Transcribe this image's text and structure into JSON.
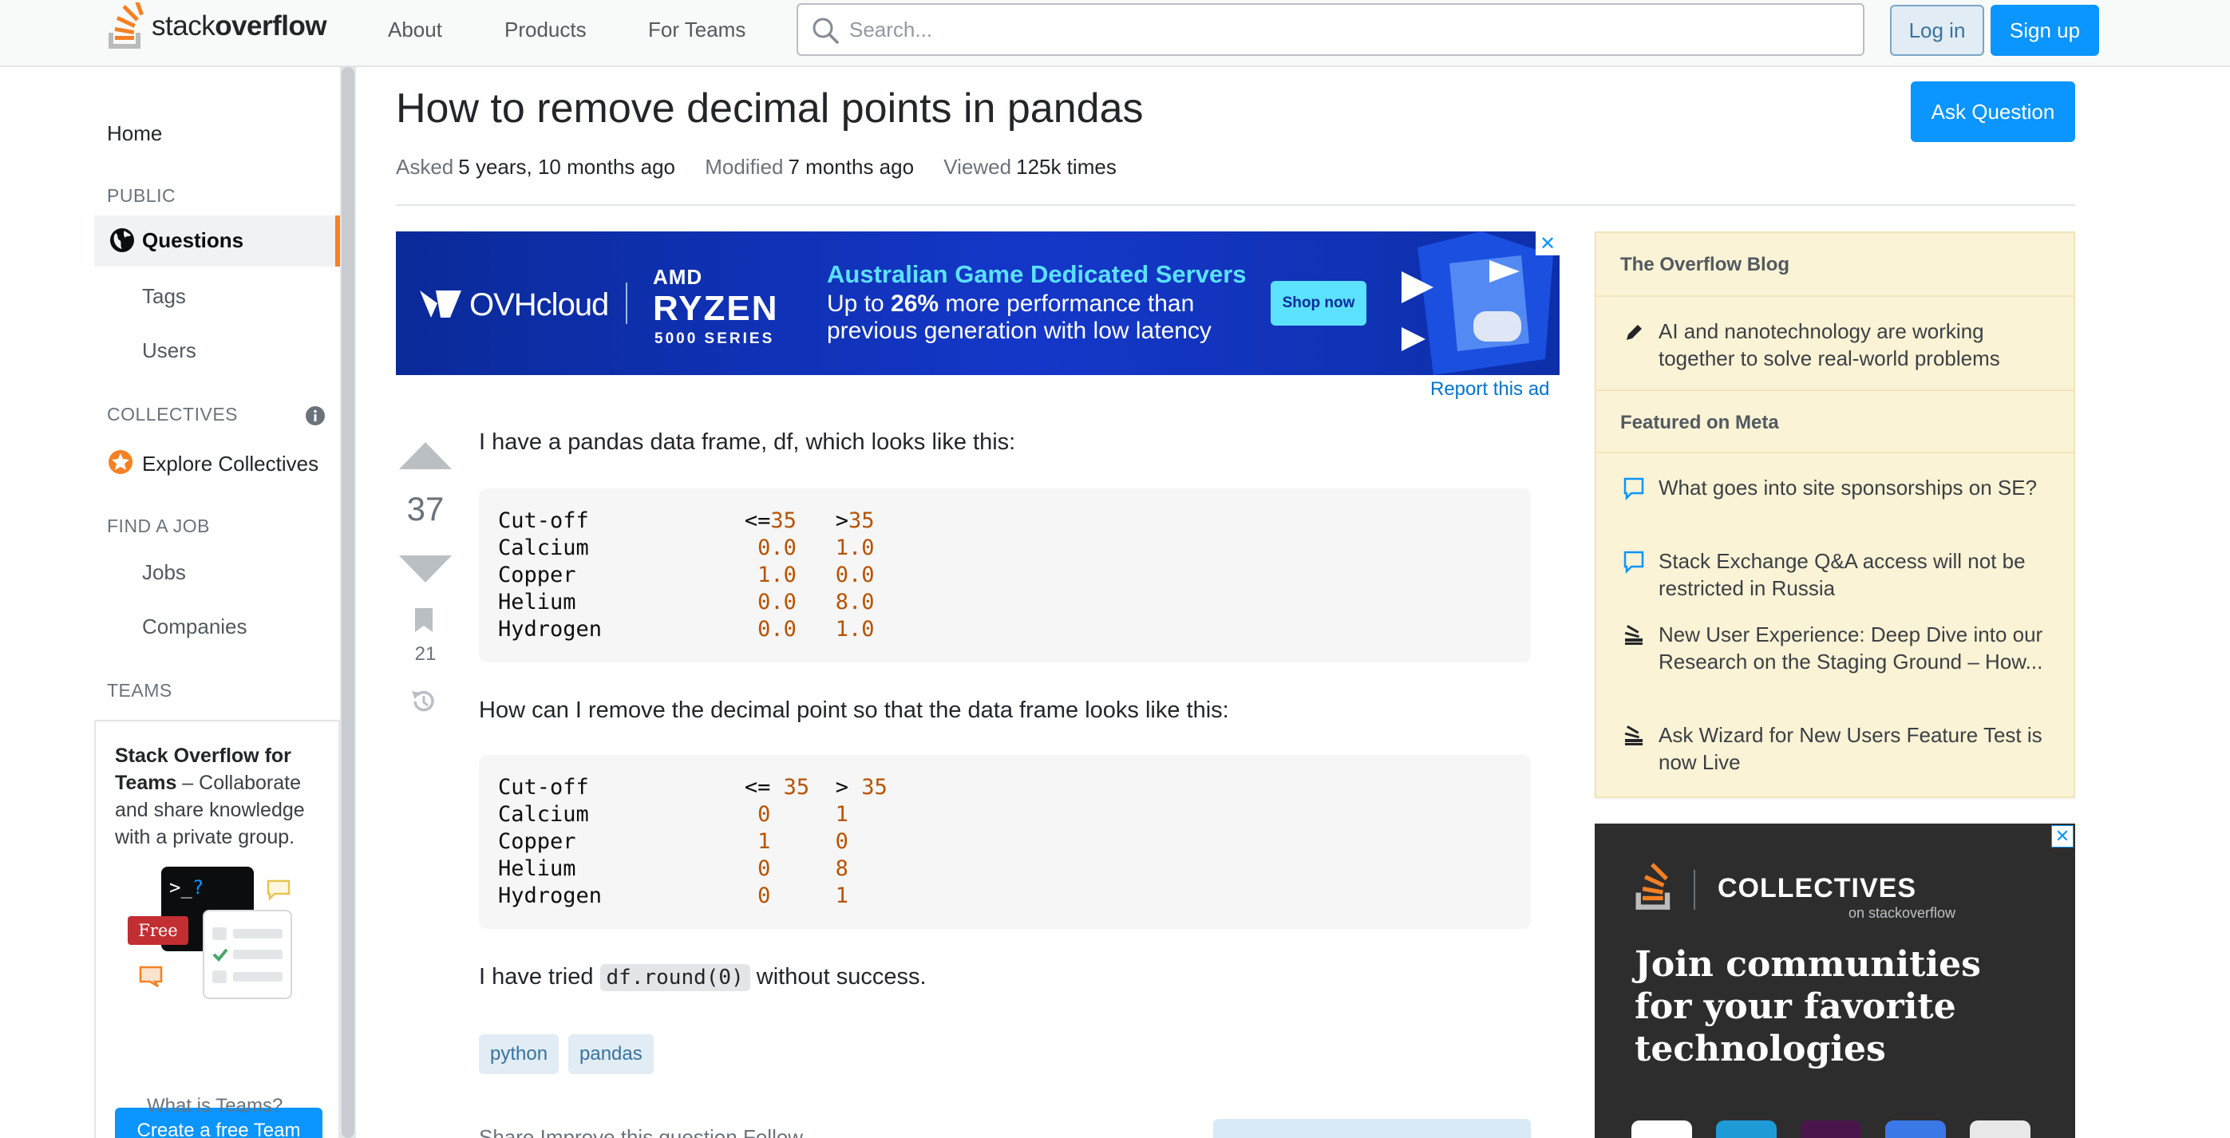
{
  "header": {
    "logo_text_light": "stack",
    "logo_text_bold": "overflow",
    "nav": [
      "About",
      "Products",
      "For Teams"
    ],
    "search_placeholder": "Search...",
    "login_label": "Log in",
    "signup_label": "Sign up"
  },
  "sidebar": {
    "home": "Home",
    "public_heading": "PUBLIC",
    "questions": "Questions",
    "tags": "Tags",
    "users": "Users",
    "collectives_heading": "COLLECTIVES",
    "explore_collectives": "Explore Collectives",
    "find_job_heading": "FIND A JOB",
    "jobs": "Jobs",
    "companies": "Companies",
    "teams_heading": "TEAMS",
    "teams_promo_bold": "Stack Overflow for Teams",
    "teams_promo_rest": " – Collaborate and share knowledge with a private group.",
    "free_badge": "Free",
    "create_team_button": "Create a free Team",
    "what_is_teams": "What is Teams?"
  },
  "question": {
    "title": "How to remove decimal points in pandas",
    "ask_button": "Ask Question",
    "asked_label": "Asked",
    "asked_value": "5 years, 10 months ago",
    "modified_label": "Modified",
    "modified_value": "7 months ago",
    "viewed_label": "Viewed",
    "viewed_value": "125k times",
    "votes": "37",
    "bookmarks": "21",
    "intro": "I have a pandas data frame, df, which looks like this:",
    "question_text": "How can I remove the decimal point so that the data frame looks like this:",
    "tried_prefix": "I have tried ",
    "tried_code": "df.round(0)",
    "tried_suffix": " without success.",
    "tags": [
      "python",
      "pandas"
    ],
    "footer_links": "Share  Improve this question  Follow"
  },
  "code1": {
    "header": [
      "Cut-off",
      "<=",
      "35",
      ">",
      "35"
    ],
    "rows": [
      [
        "Calcium",
        "0.0",
        "1.0"
      ],
      [
        "Copper",
        "1.0",
        "0.0"
      ],
      [
        "Helium",
        "0.0",
        "8.0"
      ],
      [
        "Hydrogen",
        "0.0",
        "1.0"
      ]
    ]
  },
  "code2": {
    "header": [
      "Cut-off",
      "<= ",
      "35",
      "> ",
      "35"
    ],
    "rows": [
      [
        "Calcium",
        "0",
        "1"
      ],
      [
        "Copper",
        "1",
        "0"
      ],
      [
        "Helium",
        "0",
        "8"
      ],
      [
        "Hydrogen",
        "0",
        "1"
      ]
    ]
  },
  "ad": {
    "brand": "OVHcloud",
    "chip_line1": "AMD",
    "chip_line2": "RYZEN",
    "chip_line3": "5000 SERIES",
    "headline": "Australian Game Dedicated Servers",
    "body_pre": "Up to ",
    "body_bold": "26%",
    "body_post": " more performance than",
    "body_line2": "previous generation with low latency",
    "cta": "Shop now",
    "report": "Report this ad"
  },
  "blog_widget": {
    "blog_heading": "The Overflow Blog",
    "blog_items": [
      "AI and nanotechnology are working together to solve real-world problems"
    ],
    "meta_heading": "Featured on Meta",
    "meta_items": [
      "What goes into site sponsorships on SE?",
      "Stack Exchange Q&A access will not be restricted in Russia",
      "New User Experience: Deep Dive into our Research on the Staging Ground – How...",
      "Ask Wizard for New Users Feature Test is now Live"
    ]
  },
  "collectives_ad": {
    "brand": "COLLECTIVES",
    "sub": "on stackoverflow",
    "headline_1": "Join communities",
    "headline_2": "for your favorite",
    "headline_3": "technologies"
  },
  "colors": {
    "accent_blue": "#0a95ff",
    "orange": "#f48225",
    "code_number": "#b75301",
    "widget_bg": "#fbf3d5"
  }
}
